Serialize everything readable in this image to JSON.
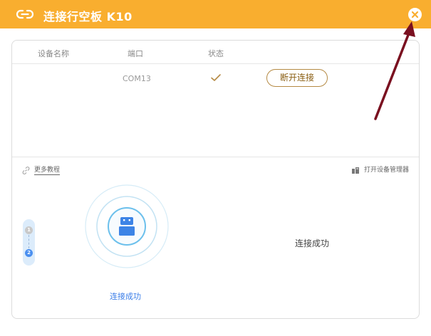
{
  "window": {
    "title": "连接行空板 K10",
    "title_icon": "link-icon",
    "close_icon": "close-icon",
    "accent_color": "#f9ae2f"
  },
  "table": {
    "headers": [
      "设备名称",
      "端口",
      "状态"
    ],
    "rows": [
      {
        "name": "",
        "port": "COM13",
        "status_icon": "check-icon",
        "action_label": "断开连接"
      }
    ]
  },
  "links": {
    "more_tutorials": "更多教程",
    "open_device_manager": "打开设备管理器"
  },
  "stepper": {
    "steps": [
      "1",
      "2"
    ],
    "current_step": 2
  },
  "status": {
    "left_label": "连接成功",
    "right_label": "连接成功"
  }
}
